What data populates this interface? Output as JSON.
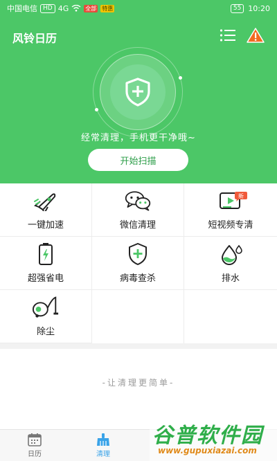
{
  "status": {
    "carrier": "中国电信",
    "hd": "HD",
    "signal": "4G",
    "battery": "55",
    "time": "10:20",
    "badge_red": "全部",
    "badge_yellow": "特惠"
  },
  "header": {
    "title": "风铃日历",
    "menu_icon": "menu-list-icon",
    "warning_icon": "warning-icon"
  },
  "hero": {
    "tagline": "经常清理，手机更干净哦~",
    "scan_button": "开始扫描",
    "shield_icon": "shield-plus-icon"
  },
  "features": [
    {
      "label": "一键加速",
      "icon": "rocket-icon"
    },
    {
      "label": "微信清理",
      "icon": "wechat-icon"
    },
    {
      "label": "短视频专清",
      "icon": "video-icon",
      "badge": "新"
    },
    {
      "label": "超强省电",
      "icon": "battery-icon"
    },
    {
      "label": "病毒查杀",
      "icon": "shield-plus-icon"
    },
    {
      "label": "排水",
      "icon": "water-drop-icon"
    },
    {
      "label": "除尘",
      "icon": "vacuum-icon"
    }
  ],
  "slogan": "-让清理更简单-",
  "tabs": [
    {
      "label": "日历",
      "icon": "calendar-icon",
      "active": false
    },
    {
      "label": "清理",
      "icon": "broom-icon",
      "active": true
    }
  ],
  "watermark": {
    "cn": "谷普软件园",
    "en": "www.gupuxiazai.com"
  },
  "colors": {
    "brand_green": "#4cc767",
    "active_tab": "#3aa3e8",
    "warning": "#f26b21"
  }
}
